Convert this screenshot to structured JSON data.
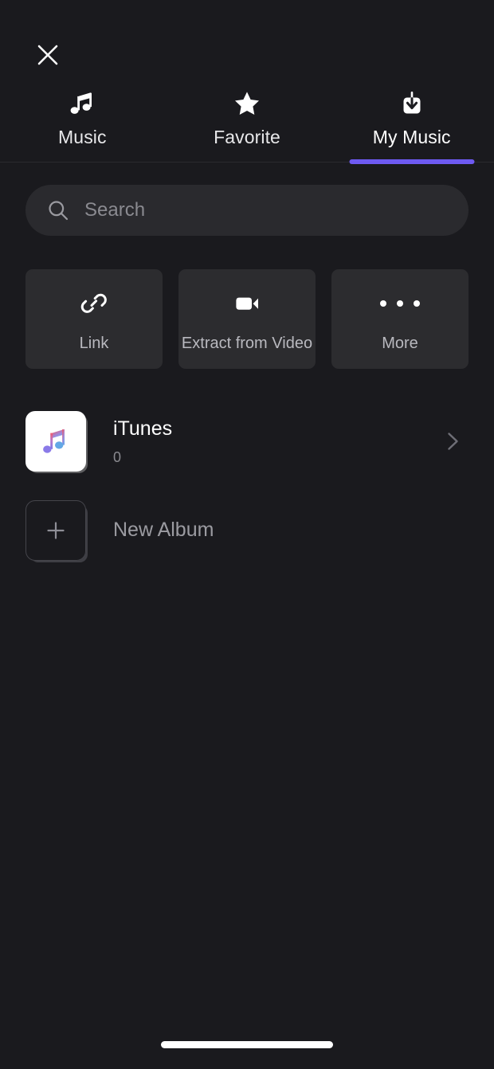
{
  "window": {
    "background_color": "#1a1a1e",
    "accent_color": "#6e5af2"
  },
  "header": {
    "close_label": "Close",
    "close_icon": "close-icon"
  },
  "tabs": {
    "active_index": 2,
    "items": [
      {
        "label": "Music",
        "icon": "music-note-icon",
        "active": false
      },
      {
        "label": "Favorite",
        "icon": "star-icon",
        "active": false
      },
      {
        "label": "My Music",
        "icon": "download-icon",
        "active": true
      }
    ]
  },
  "search": {
    "placeholder": "Search",
    "value": "",
    "icon": "search-icon"
  },
  "actions": [
    {
      "label": "Link",
      "icon": "link-icon"
    },
    {
      "label": "Extract from Video",
      "icon": "video-camera-icon"
    },
    {
      "label": "More",
      "icon": "ellipsis-icon"
    }
  ],
  "albums": [
    {
      "title": "iTunes",
      "count": "0",
      "icon": "itunes-music-note-icon",
      "chevron": "chevron-right-icon"
    }
  ],
  "new_album": {
    "label": "New Album",
    "icon": "plus-icon"
  },
  "system": {
    "home_indicator": "home-indicator"
  }
}
